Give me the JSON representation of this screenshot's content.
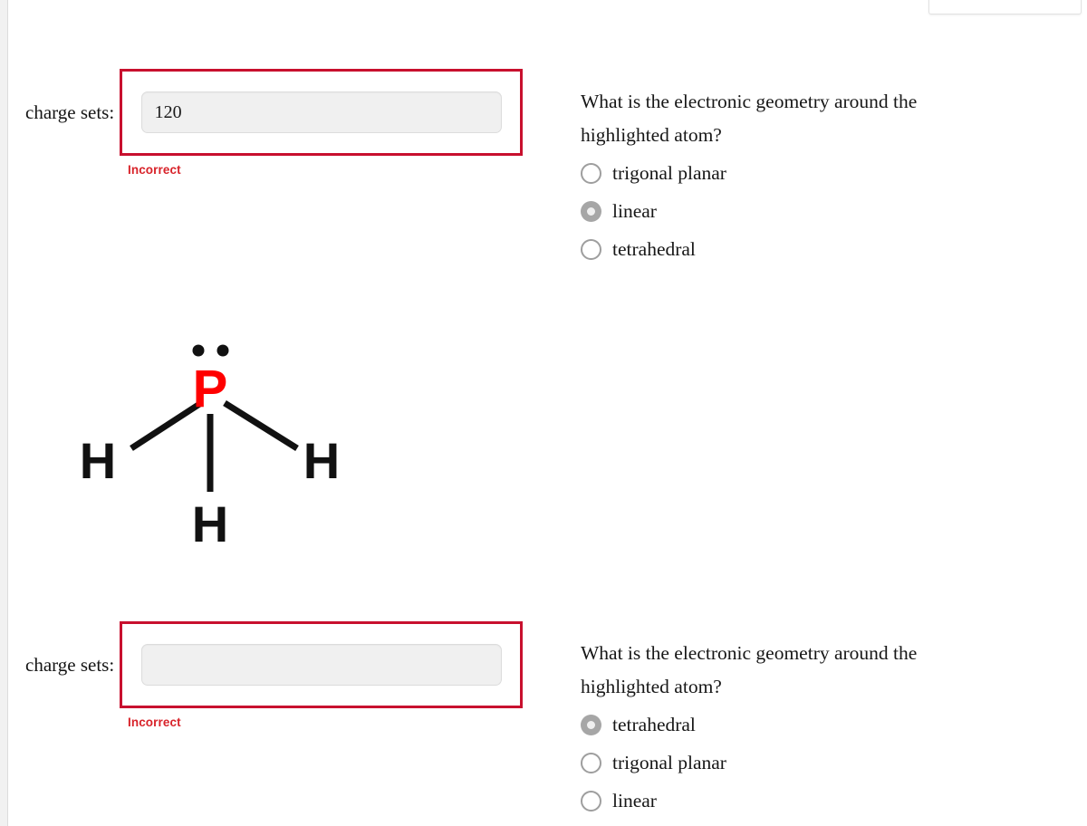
{
  "page": {
    "background": "#ffffff",
    "accent_error": "#c8102e",
    "error_text_color": "#d8232a"
  },
  "answers": [
    {
      "label": "charge sets:",
      "value": "120",
      "placeholder": "",
      "feedback": "Incorrect"
    },
    {
      "label": "charge sets:",
      "value": "",
      "placeholder": "",
      "feedback": "Incorrect"
    }
  ],
  "questions": [
    {
      "prompt": "What is the electronic geometry around the highlighted atom?",
      "options": [
        {
          "label": "trigonal planar",
          "selected": false
        },
        {
          "label": "linear",
          "selected": true
        },
        {
          "label": "tetrahedral",
          "selected": false
        }
      ]
    },
    {
      "prompt": "What is the electronic geometry around the highlighted atom?",
      "options": [
        {
          "label": "tetrahedral",
          "selected": true
        },
        {
          "label": "trigonal planar",
          "selected": false
        },
        {
          "label": "linear",
          "selected": false
        }
      ]
    }
  ],
  "molecule": {
    "name": "lewis-structure-PH3",
    "central_atom": {
      "symbol": "P",
      "color": "#ff0000"
    },
    "lone_pairs": 1,
    "lone_pair_dot_color": "#111111",
    "ligands": [
      {
        "symbol": "H",
        "position": "left",
        "color": "#111111"
      },
      {
        "symbol": "H",
        "position": "bottom",
        "color": "#111111"
      },
      {
        "symbol": "H",
        "position": "right",
        "color": "#111111"
      }
    ],
    "bond_color": "#111111"
  }
}
